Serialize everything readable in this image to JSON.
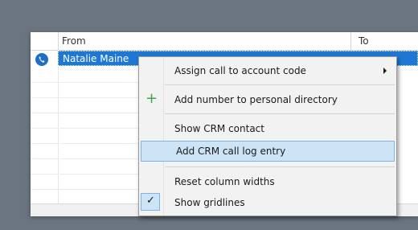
{
  "table": {
    "columns": [
      "From",
      "To"
    ],
    "selected_row": {
      "from": "Natalie Maine"
    }
  },
  "context_menu": {
    "items": [
      {
        "label": "Assign call to account code",
        "icon": "submenu-arrow-icon",
        "highlighted": false
      },
      {
        "label": "Add number to personal directory",
        "icon": "plus-icon",
        "highlighted": false
      },
      {
        "label": "Show CRM contact",
        "icon": "",
        "highlighted": false
      },
      {
        "label": "Add CRM call log entry",
        "icon": "",
        "highlighted": true
      },
      {
        "label": "Reset column widths",
        "icon": "",
        "highlighted": false
      },
      {
        "label": "Show gridlines",
        "icon": "check-icon",
        "checked": true
      }
    ],
    "plus_glyph": "+",
    "check_glyph": "✓"
  },
  "colors": {
    "selection": "#1e78d3",
    "menu_highlight": "#cde4f7",
    "plus": "#3fa54a"
  }
}
